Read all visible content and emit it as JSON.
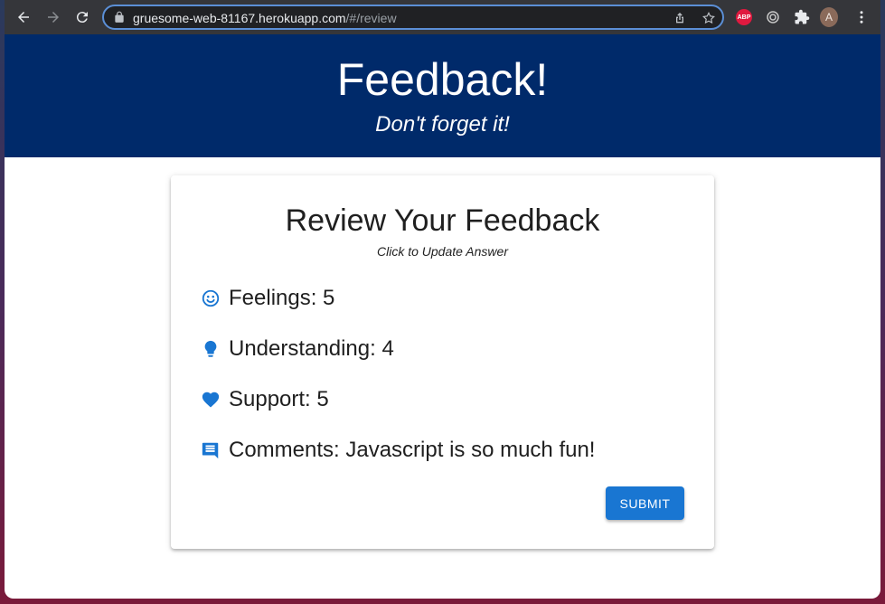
{
  "browser": {
    "url_host": "gruesome-web-81167.herokuapp.com",
    "url_path": "/#/review",
    "abp_label": "ABP",
    "profile_initial": "A"
  },
  "header": {
    "title": "Feedback!",
    "subtitle": "Don't forget it!"
  },
  "review": {
    "title": "Review Your Feedback",
    "subtitle": "Click to Update Answer",
    "items": [
      {
        "icon": "smiley-icon",
        "text": "Feelings: 5"
      },
      {
        "icon": "lightbulb-icon",
        "text": "Understanding: 4"
      },
      {
        "icon": "heart-icon",
        "text": "Support: 5"
      },
      {
        "icon": "comment-icon",
        "text": "Comments: Javascript is so much fun!"
      }
    ],
    "submit_label": "SUBMIT"
  },
  "colors": {
    "header_bg": "#002a6a",
    "accent": "#1976d2"
  }
}
